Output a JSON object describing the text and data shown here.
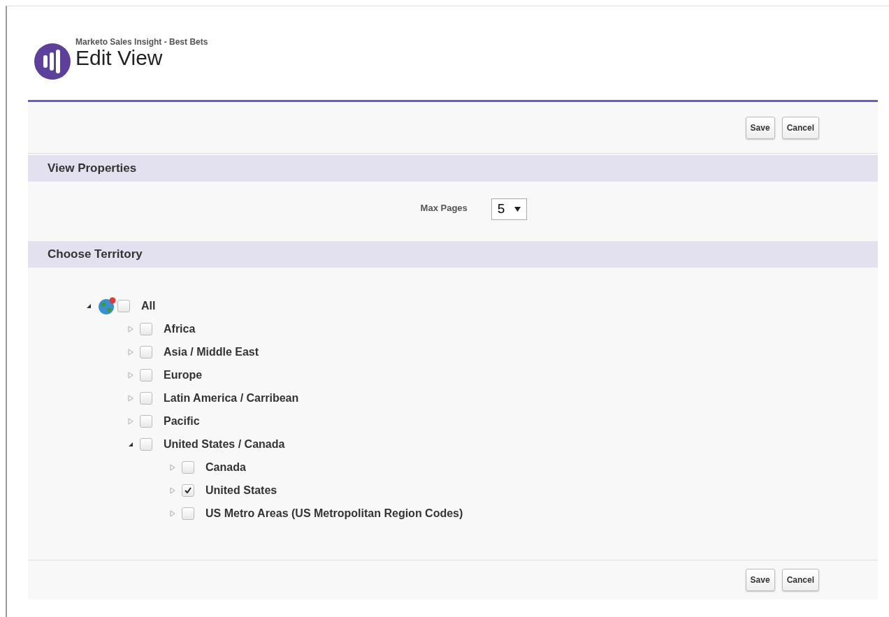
{
  "header": {
    "app_name": "Marketo Sales Insight - Best Bets",
    "title": "Edit View"
  },
  "top_buttons": [
    "Save",
    "Cancel"
  ],
  "view_properties": {
    "heading": "View Properties",
    "max_pages": {
      "label": "Max Pages",
      "value": "5"
    }
  },
  "territory": {
    "heading": "Choose Territory",
    "tree": [
      {
        "label": "All",
        "expanded": true,
        "checked": false,
        "children": [
          {
            "label": "Africa",
            "expanded": false,
            "checked": false
          },
          {
            "label": "Asia / Middle East",
            "expanded": false,
            "checked": false
          },
          {
            "label": "Europe",
            "expanded": false,
            "checked": false
          },
          {
            "label": "Latin America / Carribean",
            "expanded": false,
            "checked": false
          },
          {
            "label": "Pacific",
            "expanded": false,
            "checked": false
          },
          {
            "label": "United States / Canada",
            "expanded": true,
            "checked": false,
            "children": [
              {
                "label": "Canada",
                "expanded": false,
                "checked": false
              },
              {
                "label": "United States",
                "expanded": false,
                "checked": true
              },
              {
                "label": "US Metro Areas (US Metropolitan Region Codes)",
                "expanded": false,
                "checked": false
              }
            ]
          }
        ]
      }
    ]
  },
  "bottom_buttons": [
    "Save",
    "Cancel"
  ]
}
